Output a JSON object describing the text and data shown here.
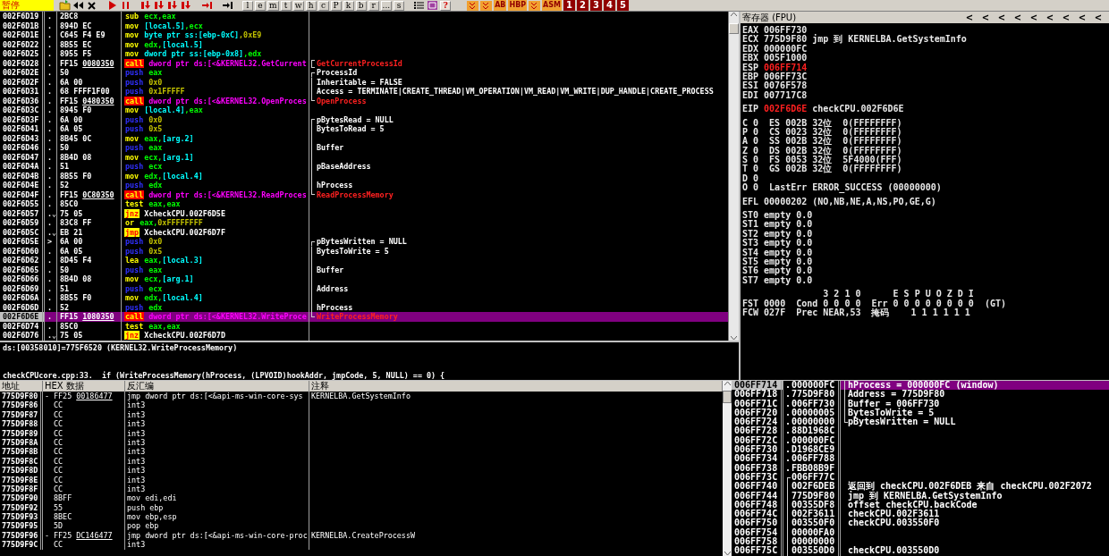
{
  "toolbar": {
    "status": "暂停",
    "letter_buttons": [
      "l",
      "e",
      "m",
      "t",
      "w",
      "h",
      "c",
      "P",
      "k",
      "b",
      "r",
      "...",
      "s"
    ],
    "help_button": "?",
    "plugin_buttons": [
      {
        "kind": "icon"
      },
      {
        "kind": "icon"
      },
      {
        "kind": "label",
        "text": "AB"
      },
      {
        "kind": "label",
        "text": "HBP"
      },
      {
        "kind": "icon"
      },
      {
        "kind": "label",
        "text": "ASM"
      }
    ],
    "window_buttons": [
      "1",
      "2",
      "3",
      "4",
      "5"
    ]
  },
  "disassembly": {
    "rows": [
      {
        "address": "002F6D19",
        "mark": ".",
        "hex": "2BC8",
        "mnemonic": {
          "text": "sub",
          "kind": "plain"
        },
        "operands": [
          {
            "text": "ecx,eax",
            "kind": "reg"
          }
        ],
        "selected": false
      },
      {
        "address": "002F6D1B",
        "mark": ".",
        "hex": "894D EC",
        "mnemonic": {
          "text": "mov",
          "kind": "plain"
        },
        "operands": [
          {
            "text": "[local.5]",
            "kind": "mem"
          },
          {
            "text": ",ecx",
            "kind": "reg"
          }
        ],
        "selected": false
      },
      {
        "address": "002F6D1E",
        "mark": ".",
        "hex": "C645 F4 E9",
        "mnemonic": {
          "text": "mov",
          "kind": "plain"
        },
        "operands": [
          {
            "text": "byte ptr ss:[ebp-0xC]",
            "kind": "mem"
          },
          {
            "text": ",0xE9",
            "kind": "imm"
          }
        ],
        "selected": false
      },
      {
        "address": "002F6D22",
        "mark": ".",
        "hex": "8B55 EC",
        "mnemonic": {
          "text": "mov",
          "kind": "plain"
        },
        "operands": [
          {
            "text": "edx,",
            "kind": "reg"
          },
          {
            "text": "[local.5]",
            "kind": "mem"
          }
        ],
        "selected": false
      },
      {
        "address": "002F6D25",
        "mark": ".",
        "hex": "8955 F5",
        "mnemonic": {
          "text": "mov",
          "kind": "plain"
        },
        "operands": [
          {
            "text": "dword ptr ss:[ebp-0x8]",
            "kind": "mem"
          },
          {
            "text": ",edx",
            "kind": "reg"
          }
        ],
        "selected": false
      },
      {
        "address": "002F6D28",
        "mark": ".",
        "hex": "FF15",
        "hex_ref": "0080350",
        "mnemonic": {
          "text": "call",
          "kind": "call"
        },
        "operands": [
          {
            "text": "dword ptr ds:[<&KERNEL32.GetCurrent",
            "kind": "sym"
          }
        ],
        "bracket": {
          "kind": "single"
        },
        "comment": {
          "text": "GetCurrentProcessId",
          "kind": "api"
        },
        "selected": false
      },
      {
        "address": "002F6D2E",
        "mark": ".",
        "hex": "50",
        "mnemonic": {
          "text": "push",
          "kind": "push"
        },
        "operands": [
          {
            "text": "eax",
            "kind": "reg"
          }
        ],
        "bracket": {
          "kind": "top"
        },
        "comment": {
          "text": "ProcessId",
          "kind": "arg"
        },
        "selected": false
      },
      {
        "address": "002F6D2F",
        "mark": ".",
        "hex": "6A 00",
        "mnemonic": {
          "text": "push",
          "kind": "push"
        },
        "operands": [
          {
            "text": "0x0",
            "kind": "imm"
          }
        ],
        "bracket": {
          "kind": "middle"
        },
        "comment": {
          "text": "Inheritable = FALSE",
          "kind": "arg"
        },
        "selected": false
      },
      {
        "address": "002F6D31",
        "mark": ".",
        "hex": "68 FFFF1F00",
        "mnemonic": {
          "text": "push",
          "kind": "push"
        },
        "operands": [
          {
            "text": "0x1FFFFF",
            "kind": "imm"
          }
        ],
        "bracket": {
          "kind": "middle"
        },
        "comment": {
          "text": "Access = TERMINATE|CREATE_THREAD|VM_OPERATION|VM_READ|VM_WRITE|DUP_HANDLE|CREATE_PROCESS",
          "kind": "arg"
        },
        "selected": false
      },
      {
        "address": "002F6D36",
        "mark": ".",
        "hex": "FF15",
        "hex_ref": "0480350",
        "mnemonic": {
          "text": "call",
          "kind": "call"
        },
        "operands": [
          {
            "text": "dword ptr ds:[<&KERNEL32.OpenProces",
            "kind": "sym"
          }
        ],
        "bracket": {
          "kind": "bottom"
        },
        "comment": {
          "text": "OpenProcess",
          "kind": "api"
        },
        "selected": false
      },
      {
        "address": "002F6D3C",
        "mark": ".",
        "hex": "8945 F0",
        "mnemonic": {
          "text": "mov",
          "kind": "plain"
        },
        "operands": [
          {
            "text": "[local.4]",
            "kind": "mem"
          },
          {
            "text": ",eax",
            "kind": "reg"
          }
        ],
        "selected": false
      },
      {
        "address": "002F6D3F",
        "mark": ".",
        "hex": "6A 00",
        "mnemonic": {
          "text": "push",
          "kind": "push"
        },
        "operands": [
          {
            "text": "0x0",
            "kind": "imm"
          }
        ],
        "bracket": {
          "kind": "top"
        },
        "comment": {
          "text": "pBytesRead = NULL",
          "kind": "arg"
        },
        "selected": false
      },
      {
        "address": "002F6D41",
        "mark": ".",
        "hex": "6A 05",
        "mnemonic": {
          "text": "push",
          "kind": "push"
        },
        "operands": [
          {
            "text": "0x5",
            "kind": "imm"
          }
        ],
        "bracket": {
          "kind": "middle"
        },
        "comment": {
          "text": "BytesToRead = 5",
          "kind": "arg"
        },
        "selected": false
      },
      {
        "address": "002F6D43",
        "mark": ".",
        "hex": "8B45 0C",
        "mnemonic": {
          "text": "mov",
          "kind": "plain"
        },
        "operands": [
          {
            "text": "eax,",
            "kind": "reg"
          },
          {
            "text": "[arg.2]",
            "kind": "mem"
          }
        ],
        "bracket": {
          "kind": "middle"
        },
        "selected": false
      },
      {
        "address": "002F6D46",
        "mark": ".",
        "hex": "50",
        "mnemonic": {
          "text": "push",
          "kind": "push"
        },
        "operands": [
          {
            "text": "eax",
            "kind": "reg"
          }
        ],
        "bracket": {
          "kind": "middle"
        },
        "comment": {
          "text": "Buffer",
          "kind": "arg"
        },
        "selected": false
      },
      {
        "address": "002F6D47",
        "mark": ".",
        "hex": "8B4D 08",
        "mnemonic": {
          "text": "mov",
          "kind": "plain"
        },
        "operands": [
          {
            "text": "ecx,",
            "kind": "reg"
          },
          {
            "text": "[arg.1]",
            "kind": "mem"
          }
        ],
        "bracket": {
          "kind": "middle"
        },
        "selected": false
      },
      {
        "address": "002F6D4A",
        "mark": ".",
        "hex": "51",
        "mnemonic": {
          "text": "push",
          "kind": "push"
        },
        "operands": [
          {
            "text": "ecx",
            "kind": "reg"
          }
        ],
        "bracket": {
          "kind": "middle"
        },
        "comment": {
          "text": "pBaseAddress",
          "kind": "arg"
        },
        "selected": false
      },
      {
        "address": "002F6D4B",
        "mark": ".",
        "hex": "8B55 F0",
        "mnemonic": {
          "text": "mov",
          "kind": "plain"
        },
        "operands": [
          {
            "text": "edx,",
            "kind": "reg"
          },
          {
            "text": "[local.4]",
            "kind": "mem"
          }
        ],
        "bracket": {
          "kind": "middle"
        },
        "selected": false
      },
      {
        "address": "002F6D4E",
        "mark": ".",
        "hex": "52",
        "mnemonic": {
          "text": "push",
          "kind": "push"
        },
        "operands": [
          {
            "text": "edx",
            "kind": "reg"
          }
        ],
        "bracket": {
          "kind": "middle"
        },
        "comment": {
          "text": "hProcess",
          "kind": "arg"
        },
        "selected": false
      },
      {
        "address": "002F6D4F",
        "mark": ".",
        "hex": "FF15",
        "hex_ref": "0C80350",
        "mnemonic": {
          "text": "call",
          "kind": "call"
        },
        "operands": [
          {
            "text": "dword ptr ds:[<&KERNEL32.ReadProces",
            "kind": "sym"
          }
        ],
        "bracket": {
          "kind": "bottom"
        },
        "comment": {
          "text": "ReadProcessMemory",
          "kind": "api"
        },
        "selected": false
      },
      {
        "address": "002F6D55",
        "mark": ".",
        "hex": "85C0",
        "mnemonic": {
          "text": "test",
          "kind": "plain"
        },
        "operands": [
          {
            "text": "eax,eax",
            "kind": "reg"
          }
        ],
        "selected": false
      },
      {
        "address": "002F6D57",
        "mark": ".⌄",
        "hex": "75 05",
        "mnemonic": {
          "text": "jnz",
          "kind": "jump"
        },
        "operands": [
          {
            "text": "XcheckCPU.002F6D5E",
            "kind": "label"
          }
        ],
        "selected": false
      },
      {
        "address": "002F6D59",
        "mark": ".",
        "hex": "83C8 FF",
        "mnemonic": {
          "text": "or",
          "kind": "plain"
        },
        "operands": [
          {
            "text": "eax,",
            "kind": "reg"
          },
          {
            "text": "0xFFFFFFFF",
            "kind": "imm"
          }
        ],
        "selected": false
      },
      {
        "address": "002F6D5C",
        "mark": ".⌄",
        "hex": "EB 21",
        "mnemonic": {
          "text": "jmp",
          "kind": "jump"
        },
        "operands": [
          {
            "text": "XcheckCPU.002F6D7F",
            "kind": "label"
          }
        ],
        "selected": false
      },
      {
        "address": "002F6D5E",
        "mark": ">",
        "hex": "6A 00",
        "mnemonic": {
          "text": "push",
          "kind": "push"
        },
        "operands": [
          {
            "text": "0x0",
            "kind": "imm"
          }
        ],
        "bracket": {
          "kind": "top"
        },
        "comment": {
          "text": "pBytesWritten = NULL",
          "kind": "arg"
        },
        "selected": false
      },
      {
        "address": "002F6D60",
        "mark": ".",
        "hex": "6A 05",
        "mnemonic": {
          "text": "push",
          "kind": "push"
        },
        "operands": [
          {
            "text": "0x5",
            "kind": "imm"
          }
        ],
        "bracket": {
          "kind": "middle"
        },
        "comment": {
          "text": "BytesToWrite = 5",
          "kind": "arg"
        },
        "selected": false
      },
      {
        "address": "002F6D62",
        "mark": ".",
        "hex": "8D45 F4",
        "mnemonic": {
          "text": "lea",
          "kind": "plain"
        },
        "operands": [
          {
            "text": "eax,",
            "kind": "reg"
          },
          {
            "text": "[local.3]",
            "kind": "mem"
          }
        ],
        "bracket": {
          "kind": "middle"
        },
        "selected": false
      },
      {
        "address": "002F6D65",
        "mark": ".",
        "hex": "50",
        "mnemonic": {
          "text": "push",
          "kind": "push"
        },
        "operands": [
          {
            "text": "eax",
            "kind": "reg"
          }
        ],
        "bracket": {
          "kind": "middle"
        },
        "comment": {
          "text": "Buffer",
          "kind": "arg"
        },
        "selected": false
      },
      {
        "address": "002F6D66",
        "mark": ".",
        "hex": "8B4D 08",
        "mnemonic": {
          "text": "mov",
          "kind": "plain"
        },
        "operands": [
          {
            "text": "ecx,",
            "kind": "reg"
          },
          {
            "text": "[arg.1]",
            "kind": "mem"
          }
        ],
        "bracket": {
          "kind": "middle"
        },
        "selected": false
      },
      {
        "address": "002F6D69",
        "mark": ".",
        "hex": "51",
        "mnemonic": {
          "text": "push",
          "kind": "push"
        },
        "operands": [
          {
            "text": "ecx",
            "kind": "reg"
          }
        ],
        "bracket": {
          "kind": "middle"
        },
        "comment": {
          "text": "Address",
          "kind": "arg"
        },
        "selected": false
      },
      {
        "address": "002F6D6A",
        "mark": ".",
        "hex": "8B55 F0",
        "mnemonic": {
          "text": "mov",
          "kind": "plain"
        },
        "operands": [
          {
            "text": "edx,",
            "kind": "reg"
          },
          {
            "text": "[local.4]",
            "kind": "mem"
          }
        ],
        "bracket": {
          "kind": "middle"
        },
        "selected": false
      },
      {
        "address": "002F6D6D",
        "mark": ".",
        "hex": "52",
        "mnemonic": {
          "text": "push",
          "kind": "push"
        },
        "operands": [
          {
            "text": "edx",
            "kind": "reg"
          }
        ],
        "bracket": {
          "kind": "middle"
        },
        "comment": {
          "text": "hProcess",
          "kind": "arg"
        },
        "selected": false
      },
      {
        "address": "002F6D6E",
        "mark": ".",
        "hex": "FF15",
        "hex_ref": "1080350",
        "mnemonic": {
          "text": "call",
          "kind": "call"
        },
        "operands": [
          {
            "text": "dword ptr ds:[<&KERNEL32.WriteProce",
            "kind": "sym"
          }
        ],
        "bracket": {
          "kind": "bottom"
        },
        "comment": {
          "text": "WriteProcessMemory",
          "kind": "api"
        },
        "selected": true
      },
      {
        "address": "002F6D74",
        "mark": ".",
        "hex": "85C0",
        "mnemonic": {
          "text": "test",
          "kind": "plain"
        },
        "operands": [
          {
            "text": "eax,eax",
            "kind": "reg"
          }
        ],
        "selected": false
      },
      {
        "address": "002F6D76",
        "mark": ".⌄",
        "hex": "75 05",
        "mnemonic": {
          "text": "jnz",
          "kind": "jump"
        },
        "operands": [
          {
            "text": "XcheckCPU.002F6D7D",
            "kind": "label"
          }
        ],
        "selected": false
      }
    ]
  },
  "info": {
    "lines": [
      "ds:[00358010]=775F6520 (KERNEL32.WriteProcessMemory)",
      "checkCPUcore.cpp:33.  if (WriteProcessMemory(hProcess, (LPVOID)hookAddr, jmpCode, 5, NULL) == 0) {"
    ]
  },
  "registers": {
    "title": "寄存器 (FPU)",
    "arrows": [
      "<",
      "<",
      "<",
      "<",
      "<",
      "<",
      "<",
      "<",
      "<"
    ],
    "general": [
      {
        "name": "EAX",
        "value": "006FF730",
        "changed": false
      },
      {
        "name": "ECX",
        "value": "775D9F80",
        "changed": false,
        "comment": "jmp 到 KERNELBA.GetSystemInfo"
      },
      {
        "name": "EDX",
        "value": "000000FC",
        "changed": false
      },
      {
        "name": "EBX",
        "value": "005F1000",
        "changed": false
      },
      {
        "name": "ESP",
        "value": "006FF714",
        "changed": true
      },
      {
        "name": "EBP",
        "value": "006FF73C",
        "changed": false
      },
      {
        "name": "ESI",
        "value": "0076F578",
        "changed": false
      },
      {
        "name": "EDI",
        "value": "007717C8",
        "changed": false
      }
    ],
    "eip": {
      "name": "EIP",
      "value": "002F6D6E",
      "changed": true,
      "comment": "checkCPU.002F6D6E"
    },
    "flags": [
      "C 0  ES 002B 32位  0(FFFFFFFF)",
      "P 0  CS 0023 32位  0(FFFFFFFF)",
      "A 0  SS 002B 32位  0(FFFFFFFF)",
      "Z 0  DS 002B 32位  0(FFFFFFFF)",
      "S 0  FS 0053 32位  5F4000(FFF)",
      "T 0  GS 002B 32位  0(FFFFFFFF)",
      "D 0",
      "O 0  LastErr ERROR_SUCCESS (00000000)"
    ],
    "efl": "EFL 00000202 (NO,NB,NE,A,NS,PO,GE,G)",
    "fpu": [
      "ST0 empty 0.0",
      "ST1 empty 0.0",
      "ST2 empty 0.0",
      "ST3 empty 0.0",
      "ST4 empty 0.0",
      "ST5 empty 0.0",
      "ST6 empty 0.0",
      "ST7 empty 0.0"
    ],
    "fpu_status": [
      "               3 2 1 0      E S P U O Z D I",
      "FST 0000  Cond 0 0 0 0  Err 0 0 0 0 0 0 0 0  (GT)",
      "FCW 027F  Prec NEAR,53  掩码    1 1 1 1 1 1"
    ]
  },
  "code_view": {
    "columns": [
      "地址",
      "HEX 数据",
      "反汇编",
      "注释"
    ],
    "rows": [
      {
        "address": "775D9F80",
        "mark": "-",
        "hex": "FF25",
        "hex_ref": "00186477",
        "text": "jmp dword ptr ds:[<&api-ms-win-core-sys",
        "comment": "KERNELBA.GetSystemInfo"
      },
      {
        "address": "775D9F86",
        "hex": "CC",
        "text": "int3"
      },
      {
        "address": "775D9F87",
        "hex": "CC",
        "text": "int3"
      },
      {
        "address": "775D9F88",
        "hex": "CC",
        "text": "int3"
      },
      {
        "address": "775D9F89",
        "hex": "CC",
        "text": "int3"
      },
      {
        "address": "775D9F8A",
        "hex": "CC",
        "text": "int3"
      },
      {
        "address": "775D9F8B",
        "hex": "CC",
        "text": "int3"
      },
      {
        "address": "775D9F8C",
        "hex": "CC",
        "text": "int3"
      },
      {
        "address": "775D9F8D",
        "hex": "CC",
        "text": "int3"
      },
      {
        "address": "775D9F8E",
        "hex": "CC",
        "text": "int3"
      },
      {
        "address": "775D9F8F",
        "hex": "CC",
        "text": "int3"
      },
      {
        "address": "775D9F90",
        "hex": "8BFF",
        "text": "mov edi,edi"
      },
      {
        "address": "775D9F92",
        "hex": "55",
        "text": "push ebp"
      },
      {
        "address": "775D9F93",
        "hex": "8BEC",
        "text": "mov ebp,esp"
      },
      {
        "address": "775D9F95",
        "hex": "5D",
        "text": "pop ebp"
      },
      {
        "address": "775D9F96",
        "mark": "-",
        "hex": "FF25",
        "hex_ref": "DC146477",
        "text": "jmp dword ptr ds:[<&api-ms-win-core-proc",
        "comment": "KERNELBA.CreateProcessW"
      },
      {
        "address": "775D9F9C",
        "hex": "CC",
        "text": "int3"
      }
    ]
  },
  "stack": {
    "rows": [
      {
        "address": "006FF714",
        "mark": ".",
        "value": "000000FC",
        "bracket": {
          "kind": "middle"
        },
        "comment": "hProcess = 000000FC (window)",
        "selected": true
      },
      {
        "address": "006FF718",
        "mark": ".",
        "value": "775D9F80",
        "bracket": {
          "kind": "middle"
        },
        "comment": "Address = 775D9F80",
        "selected": false
      },
      {
        "address": "006FF71C",
        "mark": ".",
        "value": "006FF730",
        "bracket": {
          "kind": "middle"
        },
        "comment": "Buffer = 006FF730",
        "selected": false
      },
      {
        "address": "006FF720",
        "mark": ".",
        "value": "00000005",
        "bracket": {
          "kind": "middle"
        },
        "comment": "BytesToWrite = 5",
        "selected": false
      },
      {
        "address": "006FF724",
        "mark": ".",
        "value": "00000000",
        "bracket": {
          "kind": "bottom"
        },
        "comment": "pBytesWritten = NULL",
        "selected": false
      },
      {
        "address": "006FF728",
        "mark": ".",
        "value": "88D1968C",
        "selected": false
      },
      {
        "address": "006FF72C",
        "mark": ".",
        "value": "000000FC",
        "selected": false
      },
      {
        "address": "006FF730",
        "mark": ".",
        "value": "D1968CE9",
        "selected": false
      },
      {
        "address": "006FF734",
        "mark": ".",
        "value": "006FF788",
        "selected": false
      },
      {
        "address": "006FF738",
        "mark": ".",
        "value": "FBB08B9F",
        "selected": false
      },
      {
        "address": "006FF73C",
        "value": "006FF77C",
        "frame": {
          "kind": "top"
        },
        "selected": false
      },
      {
        "address": "006FF740",
        "value": "002F6DEB",
        "frame": {
          "kind": "middle"
        },
        "comment": "返回到 checkCPU.002F6DEB 来自 checkCPU.002F2072",
        "selected": false
      },
      {
        "address": "006FF744",
        "value": "775D9F80",
        "frame": {
          "kind": "middle"
        },
        "comment": "jmp 到 KERNELBA.GetSystemInfo",
        "selected": false
      },
      {
        "address": "006FF748",
        "value": "00355DF8",
        "frame": {
          "kind": "middle"
        },
        "comment": "offset checkCPU.backCode",
        "selected": false
      },
      {
        "address": "006FF74C",
        "value": "002F3611",
        "frame": {
          "kind": "middle"
        },
        "comment": "checkCPU.002F3611",
        "selected": false
      },
      {
        "address": "006FF750",
        "value": "003550F0",
        "frame": {
          "kind": "middle"
        },
        "comment": "checkCPU.003550F0",
        "selected": false
      },
      {
        "address": "006FF754",
        "value": "00000FA0",
        "frame": {
          "kind": "middle"
        },
        "selected": false
      },
      {
        "address": "006FF758",
        "value": "00000000",
        "frame": {
          "kind": "middle"
        },
        "selected": false
      },
      {
        "address": "006FF75C",
        "value": "003550D0",
        "frame": {
          "kind": "middle"
        },
        "comment": "checkCPU.003550D0",
        "selected": false
      }
    ]
  }
}
